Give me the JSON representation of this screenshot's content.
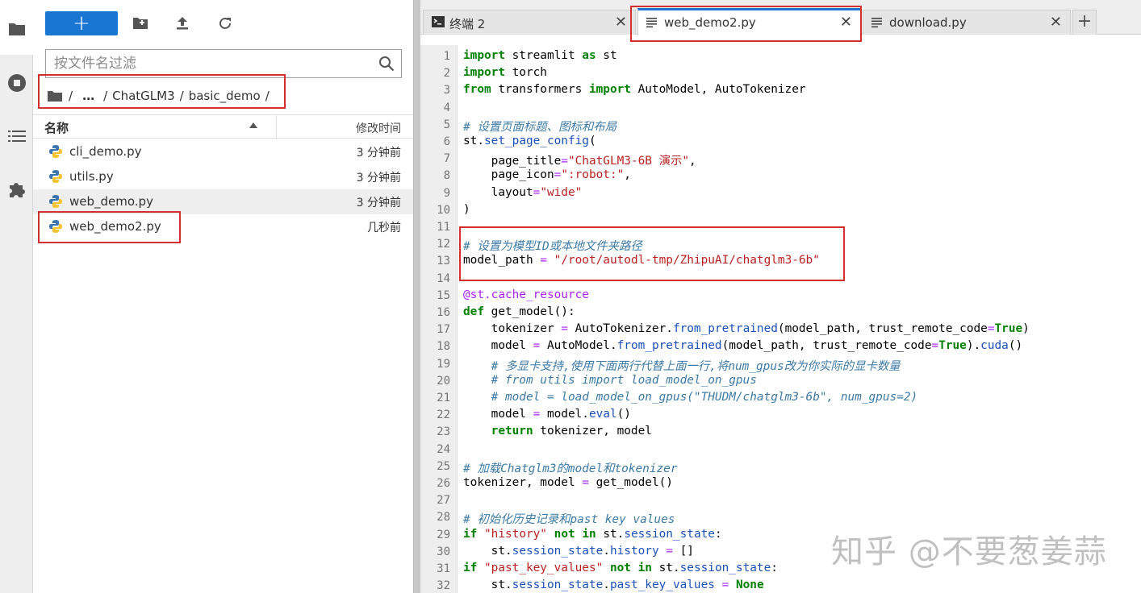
{
  "activity_bar": {
    "items": [
      {
        "icon": "folder-icon"
      },
      {
        "icon": "stop-circle-icon"
      },
      {
        "icon": "list-icon"
      },
      {
        "icon": "puzzle-icon"
      }
    ]
  },
  "file_browser": {
    "new_button_label": "+",
    "toolbar_icons": [
      "new-folder-icon",
      "upload-icon",
      "refresh-icon"
    ],
    "filter_placeholder": "按文件名过滤",
    "breadcrumb": [
      "/",
      "…",
      "/",
      "ChatGLM3",
      "/",
      "basic_demo",
      "/"
    ],
    "columns": {
      "name": "名称",
      "modified": "修改时间"
    },
    "files": [
      {
        "name": "cli_demo.py",
        "modified": "3 分钟前",
        "selected": false
      },
      {
        "name": "utils.py",
        "modified": "3 分钟前",
        "selected": false
      },
      {
        "name": "web_demo.py",
        "modified": "3 分钟前",
        "selected": true
      },
      {
        "name": "web_demo2.py",
        "modified": "几秒前",
        "selected": false
      }
    ]
  },
  "tabs": [
    {
      "label": "终端 2",
      "icon": "terminal-icon",
      "active": false
    },
    {
      "label": "web_demo2.py",
      "icon": "text-file-icon",
      "active": true
    },
    {
      "label": "download.py",
      "icon": "text-file-icon",
      "active": false
    }
  ],
  "tab_add_label": "+",
  "tab_close_label": "✕",
  "editor": {
    "line_numbers": [
      "1",
      "2",
      "3",
      "4",
      "5",
      "6",
      "7",
      "8",
      "9",
      "10",
      "11",
      "12",
      "13",
      "14",
      "15",
      "16",
      "17",
      "18",
      "19",
      "20",
      "21",
      "22",
      "23",
      "24",
      "25",
      "26",
      "27",
      "28",
      "29",
      "30",
      "31",
      "32"
    ],
    "lines": [
      "import streamlit as st",
      "import torch",
      "from transformers import AutoModel, AutoTokenizer",
      "",
      "# 设置页面标题、图标和布局",
      "st.set_page_config(",
      "    page_title=\"ChatGLM3-6B 演示\",",
      "    page_icon=\":robot:\",",
      "    layout=\"wide\"",
      ")",
      "",
      "# 设置为模型ID或本地文件夹路径",
      "model_path = \"/root/autodl-tmp/ZhipuAI/chatglm3-6b\"",
      "",
      "@st.cache_resource",
      "def get_model():",
      "    tokenizer = AutoTokenizer.from_pretrained(model_path, trust_remote_code=True)",
      "    model = AutoModel.from_pretrained(model_path, trust_remote_code=True).cuda()",
      "    # 多显卡支持,使用下面两行代替上面一行,将num_gpus改为你实际的显卡数量",
      "    # from utils import load_model_on_gpus",
      "    # model = load_model_on_gpus(\"THUDM/chatglm3-6b\", num_gpus=2)",
      "    model = model.eval()",
      "    return tokenizer, model",
      "",
      "# 加载Chatglm3的model和tokenizer",
      "tokenizer, model = get_model()",
      "",
      "# 初始化历史记录和past key values",
      "if \"history\" not in st.session_state:",
      "    st.session_state.history = []",
      "if \"past_key_values\" not in st.session_state:",
      "    st.session_state.past_key_values = None"
    ]
  },
  "watermark": "知乎 @不要葱姜蒜"
}
